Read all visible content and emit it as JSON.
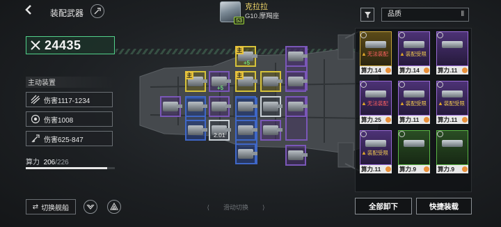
{
  "header": {
    "title": "装配武器"
  },
  "pilot": {
    "name": "克拉拉",
    "class": "G10.摩羯座",
    "level": "53"
  },
  "power": {
    "value": "24435"
  },
  "active_devices": {
    "label": "主动装置",
    "items": [
      {
        "text": "伤害1117-1234",
        "icon": "multi-shot-icon"
      },
      {
        "text": "伤害1008",
        "icon": "target-ring-icon"
      },
      {
        "text": "伤害625-847",
        "icon": "missile-icon"
      }
    ]
  },
  "compute": {
    "label": "算力",
    "current": "206",
    "max": "/226",
    "fraction": 0.9115
  },
  "slots": {
    "main_tag": "主",
    "plus5": "+5",
    "level_value": "2.01"
  },
  "inventory": {
    "sort_label": "品质",
    "cards": [
      {
        "quality": "gold",
        "warning": "无法装配",
        "warning_color": "red",
        "compute": "算力.14"
      },
      {
        "quality": "purple",
        "warning": "装配受限",
        "warning_color": "yellow",
        "compute": "算力.14"
      },
      {
        "quality": "purple",
        "warning": "",
        "warning_color": "",
        "compute": "算力.11"
      },
      {
        "quality": "purple",
        "warning": "无法装配",
        "warning_color": "red",
        "compute": "算力.25"
      },
      {
        "quality": "purple",
        "warning": "装配受限",
        "warning_color": "yellow",
        "compute": "算力.11"
      },
      {
        "quality": "purple",
        "warning": "装配受限",
        "warning_color": "yellow",
        "compute": "算力.11"
      },
      {
        "quality": "purple",
        "warning": "装配受限",
        "warning_color": "yellow",
        "compute": "算力.11"
      },
      {
        "quality": "green",
        "warning": "",
        "warning_color": "",
        "compute": "算力.9"
      },
      {
        "quality": "green",
        "warning": "",
        "warning_color": "",
        "compute": "算力.9"
      }
    ]
  },
  "footer": {
    "switch_ship": "切换舰船",
    "swipe_hint": "滑动切换",
    "unload_all": "全部卸下",
    "quick_load": "快捷装载"
  },
  "colors": {
    "accent_green": "#52d28b",
    "slot_purple": "#7a57b8",
    "slot_blue": "#3f67c7",
    "main_tag_yellow": "#e7c23b"
  }
}
